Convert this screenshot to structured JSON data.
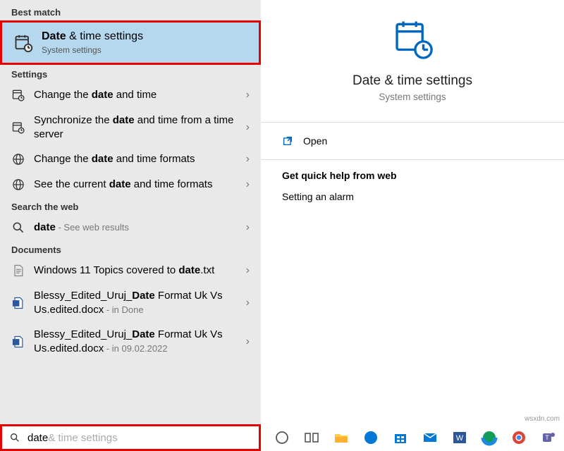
{
  "left": {
    "best_match_header": "Best match",
    "best_match": {
      "title_pre": "Date",
      "title_rest": " & time settings",
      "subtitle": "System settings"
    },
    "settings_header": "Settings",
    "settings": [
      {
        "pre": "Change the ",
        "bold": "date",
        "post": " and time"
      },
      {
        "pre": "Synchronize the ",
        "bold": "date",
        "post": " and time from a time server"
      },
      {
        "pre": "Change the ",
        "bold": "date",
        "post": " and time formats"
      },
      {
        "pre": "See the current ",
        "bold": "date",
        "post": " and time formats"
      }
    ],
    "search_web_header": "Search the web",
    "web": {
      "bold": "date",
      "post": " - See web results"
    },
    "documents_header": "Documents",
    "docs": [
      {
        "pre": "Windows 11 Topics covered to ",
        "bold": "date",
        "post": ".txt",
        "meta": ""
      },
      {
        "pre": "Blessy_Edited_Uruj_",
        "bold": "Date",
        "post": " Format Uk Vs Us.edited.docx",
        "meta": " - in Done"
      },
      {
        "pre": "Blessy_Edited_Uruj_",
        "bold": "Date",
        "post": " Format Uk Vs Us.edited.docx",
        "meta": " - in 09.02.2022"
      }
    ]
  },
  "right": {
    "title": "Date & time settings",
    "subtitle": "System settings",
    "open_label": "Open",
    "help_header": "Get quick help from web",
    "help_link": "Setting an alarm"
  },
  "search": {
    "typed": "date",
    "ghost": " & time settings"
  },
  "watermark": "wsxdn.com"
}
